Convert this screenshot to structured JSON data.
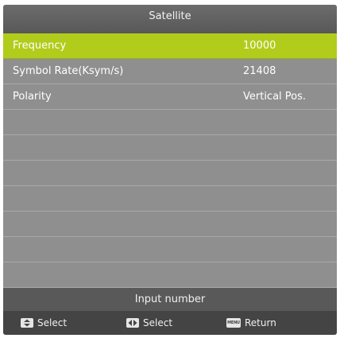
{
  "title": "Satellite",
  "rows": [
    {
      "label": "Frequency",
      "value": "10000",
      "selected": true
    },
    {
      "label": "Symbol Rate(Ksym/s)",
      "value": "21408",
      "selected": false
    },
    {
      "label": "Polarity",
      "value": "Vertical Pos.",
      "selected": false
    },
    {
      "label": "",
      "value": "",
      "selected": false
    },
    {
      "label": "",
      "value": "",
      "selected": false
    },
    {
      "label": "",
      "value": "",
      "selected": false
    },
    {
      "label": "",
      "value": "",
      "selected": false
    },
    {
      "label": "",
      "value": "",
      "selected": false
    },
    {
      "label": "",
      "value": "",
      "selected": false
    },
    {
      "label": "",
      "value": "",
      "selected": false
    }
  ],
  "hint": "Input number",
  "footer": {
    "updown": {
      "icon": "up-down-arrow-icon",
      "label": "Select"
    },
    "leftright": {
      "icon": "left-right-arrow-icon",
      "label": "Select"
    },
    "menu": {
      "icon": "menu-key-icon",
      "key_text": "MENU",
      "label": "Return"
    }
  },
  "colors": {
    "selected_row": "#b2cc1c",
    "panel": "#8f8f8f",
    "title_bar": "#626262",
    "hint_bar": "#595959",
    "footer": "#444444"
  }
}
